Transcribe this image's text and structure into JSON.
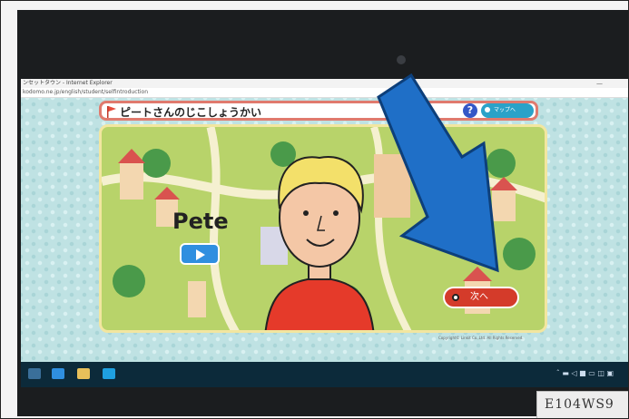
{
  "window": {
    "title": "ンセットタウン - Internet Explorer",
    "address": "kodomo.ne.jp/english/student/selfintroduction",
    "minimize_label": "—"
  },
  "header": {
    "title": "ピートさんのじこしょうかい",
    "help_label": "?",
    "map_button_label": "マップへ"
  },
  "scene": {
    "character_name": "Pete",
    "next_button_label": "次へ",
    "copyright": "Copyright© Linkit Co.,Ltd. All Rights Reserved."
  },
  "taskbar": {
    "tray_text": "ˆ ▬ ◁ ■ ▭ ◫ ▣"
  },
  "sticker": {
    "label": "E104WS9"
  },
  "colors": {
    "header_border": "#e07a6e",
    "help": "#3457c7",
    "map": "#2aa2c8",
    "next": "#d43b2a",
    "arrow": "#1f6fc7"
  },
  "icons": [
    "flag-icon",
    "help-icon",
    "play-icon",
    "next-icon",
    "arrow-icon",
    "ie-icon"
  ]
}
